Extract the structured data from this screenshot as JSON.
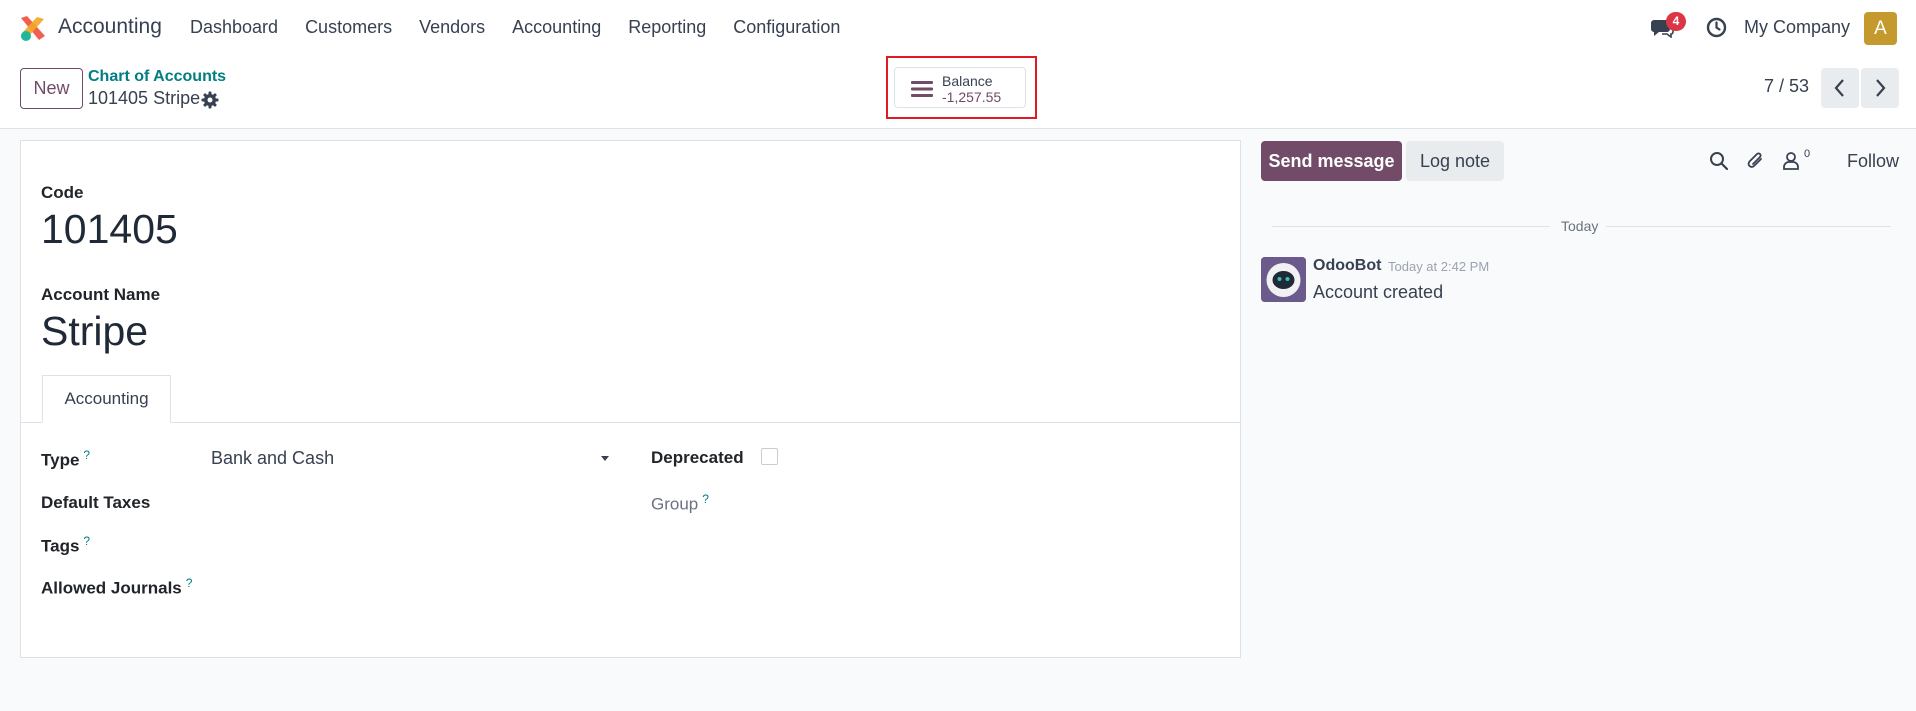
{
  "nav": {
    "app_name": "Accounting",
    "menu": [
      "Dashboard",
      "Customers",
      "Vendors",
      "Accounting",
      "Reporting",
      "Configuration"
    ],
    "message_count": "4",
    "company": "My Company",
    "avatar_initial": "A"
  },
  "control": {
    "new_label": "New",
    "breadcrumb": "Chart of Accounts",
    "record_title": "101405 Stripe",
    "balance_label": "Balance",
    "balance_value": "-1,257.55",
    "pager": "7 / 53"
  },
  "form": {
    "code_label": "Code",
    "code_value": "101405",
    "account_name_label": "Account Name",
    "account_name_value": "Stripe",
    "tab_label": "Accounting",
    "type_label": "Type",
    "type_value": "Bank and Cash",
    "help_mark": "?",
    "default_taxes_label": "Default Taxes",
    "tags_label": "Tags",
    "allowed_journals_label": "Allowed Journals",
    "deprecated_label": "Deprecated",
    "deprecated_checked": false,
    "group_label": "Group"
  },
  "chatter": {
    "send_message": "Send message",
    "log_note": "Log note",
    "followers_count": "0",
    "follow": "Follow",
    "date_separator": "Today",
    "messages": [
      {
        "author": "OdooBot",
        "time": "Today at 2:42 PM",
        "body": "Account created"
      }
    ]
  },
  "colors": {
    "primary": "#714b67",
    "link": "#017e84",
    "badge": "#dc3545",
    "highlight": "#e01b24",
    "avatar": "#c49a2f"
  }
}
